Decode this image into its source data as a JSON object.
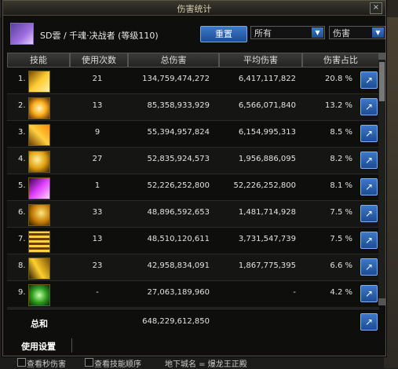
{
  "window": {
    "title": "伤害统计",
    "close_label": "×"
  },
  "header": {
    "player": "SD雲 / 千魂·决战者 (等级110)",
    "reset_label": "重置",
    "filter1": "所有",
    "filter2": "伤害"
  },
  "columns": {
    "skill": "技能",
    "uses": "使用次数",
    "total": "总伤害",
    "avg": "平均伤害",
    "pct": "伤害占比"
  },
  "rows": [
    {
      "idx": "1.",
      "uses": "21",
      "total": "134,759,474,272",
      "avg": "6,417,117,822",
      "pct": "20.8 %"
    },
    {
      "idx": "2.",
      "uses": "13",
      "total": "85,358,933,929",
      "avg": "6,566,071,840",
      "pct": "13.2 %"
    },
    {
      "idx": "3.",
      "uses": "9",
      "total": "55,394,957,824",
      "avg": "6,154,995,313",
      "pct": "8.5 %"
    },
    {
      "idx": "4.",
      "uses": "27",
      "total": "52,835,924,573",
      "avg": "1,956,886,095",
      "pct": "8.2 %"
    },
    {
      "idx": "5.",
      "uses": "1",
      "total": "52,226,252,800",
      "avg": "52,226,252,800",
      "pct": "8.1 %"
    },
    {
      "idx": "6.",
      "uses": "33",
      "total": "48,896,592,653",
      "avg": "1,481,714,928",
      "pct": "7.5 %"
    },
    {
      "idx": "7.",
      "uses": "13",
      "total": "48,510,120,611",
      "avg": "3,731,547,739",
      "pct": "7.5 %"
    },
    {
      "idx": "8.",
      "uses": "23",
      "total": "42,958,834,091",
      "avg": "1,867,775,395",
      "pct": "6.6 %"
    },
    {
      "idx": "9.",
      "uses": "-",
      "total": "27,063,189,960",
      "avg": "-",
      "pct": "4.2 %"
    }
  ],
  "icons": [
    "skill-icon-1",
    "skill-icon-2",
    "skill-icon-3",
    "skill-icon-4",
    "skill-icon-5",
    "skill-icon-6",
    "skill-icon-7",
    "skill-icon-8",
    "skill-icon-9"
  ],
  "share_label": "↗",
  "total": {
    "label": "总和",
    "value": "648,229,612,850"
  },
  "footer": {
    "usage_label": "使用设置"
  },
  "bottom": {
    "opt1": "查看秒伤害",
    "opt2": "查看技能顺序",
    "location": "地下城名 = 爆龙王正殿"
  }
}
